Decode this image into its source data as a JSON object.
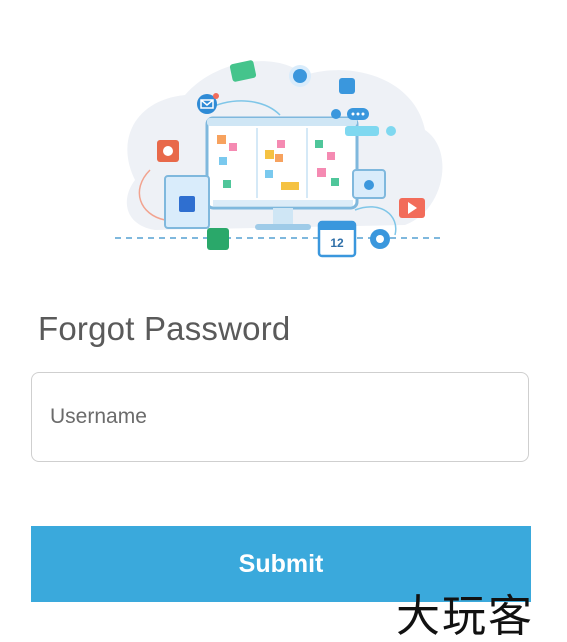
{
  "title": "Forgot Password",
  "username_field": {
    "placeholder": "Username",
    "value": ""
  },
  "submit_label": "Submit",
  "watermark": "大玩客",
  "illustration": {
    "calendar_day": "12"
  },
  "colors": {
    "accent": "#3aa9dc",
    "title_text": "#5a5a5a",
    "field_border": "#cfcfcf"
  }
}
